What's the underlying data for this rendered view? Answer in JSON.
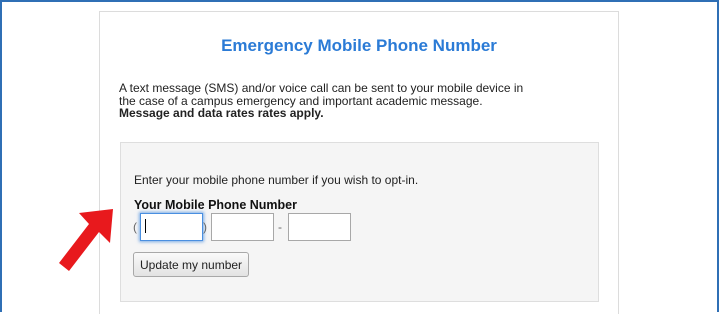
{
  "header": {
    "title": "Emergency Mobile Phone Number"
  },
  "description": {
    "line1": "A text message (SMS) and/or voice call can be sent to your mobile device in",
    "line2": "the case of a campus emergency and important academic message.",
    "bold_line": "Message and data rates rates apply."
  },
  "optin": {
    "prompt": "Enter your mobile phone number if you wish to opt-in.",
    "field_label": "Your Mobile Phone Number",
    "paren_open": "(",
    "paren_close": ")",
    "dash": "-",
    "area_value": "",
    "prefix_value": "",
    "line_value": ""
  },
  "actions": {
    "update_label": "Update my number"
  },
  "colors": {
    "title": "#2b7bd6",
    "frame": "#2f6fb5",
    "arrow": "#e8191d",
    "focus": "#4a8fe0"
  },
  "icons": {
    "pointer": "red-arrow-icon"
  }
}
